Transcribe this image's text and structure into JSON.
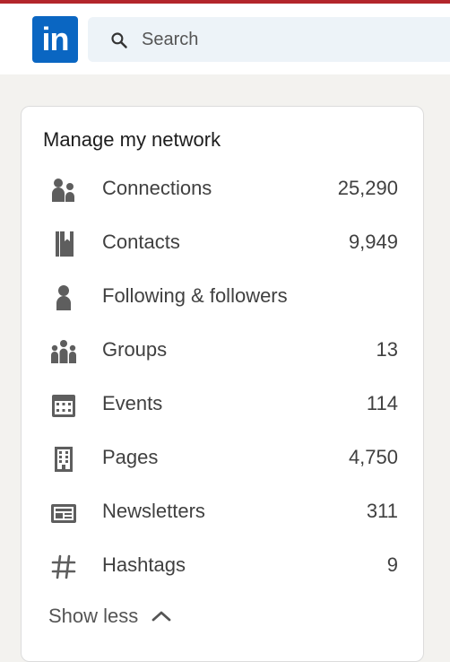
{
  "brand": {
    "logo_text": "in",
    "accent_color": "#0a66c2"
  },
  "search": {
    "placeholder": "Search"
  },
  "card": {
    "title": "Manage my network",
    "items": [
      {
        "label": "Connections",
        "count": "25,290",
        "icon": "connections-icon"
      },
      {
        "label": "Contacts",
        "count": "9,949",
        "icon": "contacts-icon"
      },
      {
        "label": "Following & followers",
        "count": "",
        "icon": "person-icon"
      },
      {
        "label": "Groups",
        "count": "13",
        "icon": "groups-icon"
      },
      {
        "label": "Events",
        "count": "114",
        "icon": "calendar-icon"
      },
      {
        "label": "Pages",
        "count": "4,750",
        "icon": "building-icon"
      },
      {
        "label": "Newsletters",
        "count": "311",
        "icon": "newsletter-icon"
      },
      {
        "label": "Hashtags",
        "count": "9",
        "icon": "hashtag-icon"
      }
    ],
    "toggle_label": "Show less"
  }
}
